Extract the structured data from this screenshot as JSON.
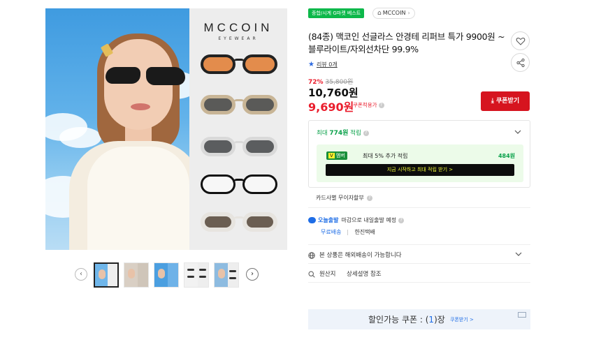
{
  "badges": {
    "gmarket_best": "종합/시계 G마켓 베스트"
  },
  "store": {
    "name": "MCCOIN"
  },
  "product": {
    "title": "(84종) 맥코인 선글라스 안경테 리퍼브 특가 9900원 ~ 블루라이트/자외선차단 99.9%",
    "review_label": "리뷰 0개",
    "discount_rate": "72%",
    "original_price": "35,800원",
    "price": "10,760원",
    "coupon_price": "9,690원",
    "coupon_applied_label": "쿠폰적용가",
    "coupon_button": "쿠폰받기"
  },
  "points": {
    "prefix": "최대",
    "amount": "774원",
    "suffix": "적립",
    "member_badge_v": "V",
    "member_badge_label": "멤버",
    "member_text": "최대 5% 추가 적립",
    "member_amount": "484원",
    "member_cta": "지금 시작하고 최대 적립 받기 >"
  },
  "installment": {
    "label": "카드사별 무이자할부"
  },
  "shipping": {
    "badge": "오늘출발",
    "text": "마감으로 내일출발 예정",
    "free": "무료배송",
    "courier": "한진택배"
  },
  "overseas": {
    "label": "본 상품은 해외배송이 가능합니다"
  },
  "origin": {
    "label": "원산지",
    "value": "상세설명 참조"
  },
  "coupon_bar": {
    "prefix": "할인가능 쿠폰 : (",
    "count": "1",
    "suffix": ")장",
    "link": "쿠폰받기 >"
  },
  "gallery": {
    "brand": "MCCOIN",
    "brand_sub": "EYEWEAR"
  },
  "colors": {
    "accent_red": "#ea1d2c",
    "button_red": "#d6141f",
    "green": "#0aa14a",
    "blue": "#1e6de6"
  }
}
